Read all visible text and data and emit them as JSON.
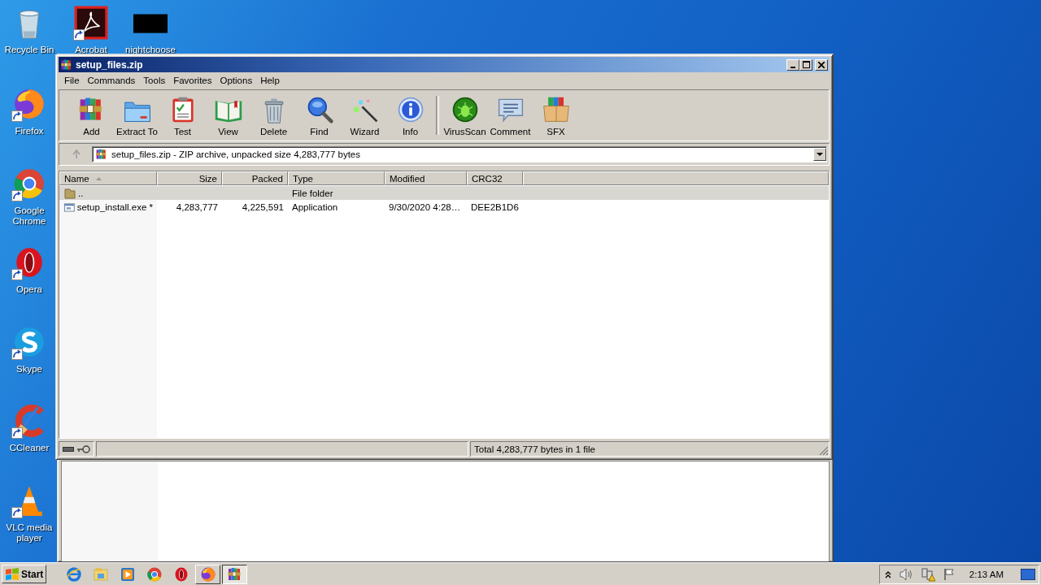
{
  "desktop_icons": [
    {
      "label": "Recycle Bin",
      "kind": "recycle",
      "shortcut": false
    },
    {
      "label": "Acrobat",
      "kind": "acrobat",
      "shortcut": true
    },
    {
      "label": "nightchoose",
      "kind": "blank",
      "shortcut": false
    },
    {
      "label": "Firefox",
      "kind": "firefox",
      "shortcut": true
    },
    {
      "label": "Google Chrome",
      "kind": "chrome",
      "shortcut": true
    },
    {
      "label": "Opera",
      "kind": "opera",
      "shortcut": true
    },
    {
      "label": "Skype",
      "kind": "skype",
      "shortcut": true
    },
    {
      "label": "CCleaner",
      "kind": "ccleaner",
      "shortcut": true
    },
    {
      "label": "VLC media player",
      "kind": "vlc",
      "shortcut": true
    }
  ],
  "window": {
    "title": "setup_files.zip"
  },
  "menu": [
    "File",
    "Commands",
    "Tools",
    "Favorites",
    "Options",
    "Help"
  ],
  "toolbar": [
    {
      "label": "Add",
      "kind": "add"
    },
    {
      "label": "Extract To",
      "kind": "extract"
    },
    {
      "label": "Test",
      "kind": "test"
    },
    {
      "label": "View",
      "kind": "view"
    },
    {
      "label": "Delete",
      "kind": "delete"
    },
    {
      "label": "Find",
      "kind": "find"
    },
    {
      "label": "Wizard",
      "kind": "wizard"
    },
    {
      "label": "Info",
      "kind": "info"
    },
    {
      "label": "VirusScan",
      "kind": "virusscan"
    },
    {
      "label": "Comment",
      "kind": "comment"
    },
    {
      "label": "SFX",
      "kind": "sfx"
    }
  ],
  "address": {
    "value": "setup_files.zip - ZIP archive, unpacked size 4,283,777 bytes"
  },
  "table": {
    "columns": [
      {
        "label": "Name",
        "sorted": true
      },
      {
        "label": "Size",
        "sorted": false
      },
      {
        "label": "Packed",
        "sorted": false
      },
      {
        "label": "Type",
        "sorted": false
      },
      {
        "label": "Modified",
        "sorted": false
      },
      {
        "label": "CRC32",
        "sorted": false
      }
    ],
    "rows": [
      {
        "kind": "folder",
        "name": "..",
        "type": "File folder",
        "selected": true
      },
      {
        "kind": "file",
        "name": "setup_install.exe *",
        "size": "4,283,777",
        "packed": "4,225,591",
        "type": "Application",
        "modified": "9/30/2020 4:28…",
        "crc32": "DEE2B1D6",
        "selected": false
      }
    ]
  },
  "status_bar": {
    "text": "Total 4,283,777 bytes in 1 file"
  },
  "taskbar": {
    "start": "Start",
    "apps": [
      {
        "kind": "ie",
        "open": false,
        "active": false
      },
      {
        "kind": "explorer",
        "open": false,
        "active": false
      },
      {
        "kind": "mediaplayer",
        "open": false,
        "active": false
      },
      {
        "kind": "chrome",
        "open": false,
        "active": false
      },
      {
        "kind": "opera",
        "open": false,
        "active": false
      },
      {
        "kind": "firefox",
        "open": true,
        "active": false
      },
      {
        "kind": "winrar",
        "open": true,
        "active": true
      }
    ],
    "time": "2:13 AM"
  }
}
